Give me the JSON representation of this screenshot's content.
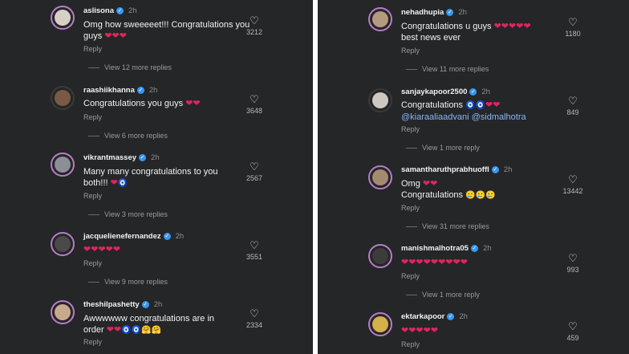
{
  "left": {
    "comments": [
      {
        "user": "aslisona",
        "time": "2h",
        "text": "Omg how sweeeeet!!! Congratulations you guys",
        "emoji": "hearts3",
        "reply": "Reply",
        "likes": "3212",
        "more": "View 12 more replies"
      },
      {
        "user": "raashiikhanna",
        "time": "2h",
        "text": "Congratulations you guys",
        "emoji": "hearts2",
        "reply": "Reply",
        "likes": "3648",
        "more": "View 6 more replies"
      },
      {
        "user": "vikrantmassey",
        "time": "2h",
        "text": "Many many congratulations to you both!!!",
        "emoji": "heart-eye",
        "reply": "Reply",
        "likes": "2567",
        "more": "View 3 more replies"
      },
      {
        "user": "jacquelienefernandez",
        "time": "2h",
        "text": "",
        "emoji": "hearts5",
        "reply": "Reply",
        "likes": "3551",
        "more": "View 9 more replies"
      },
      {
        "user": "theshilpashetty",
        "time": "2h",
        "text": "Awwwwww congratulations are in order",
        "emoji": "mix",
        "reply": "Reply",
        "likes": "2334",
        "more": ""
      }
    ]
  },
  "right": {
    "comments": [
      {
        "user": "nehadhupia",
        "time": "2h",
        "text": "Congratulations u guys",
        "text2": "best news ever",
        "emoji": "hearts5",
        "reply": "Reply",
        "likes": "1180",
        "more": "View 11 more replies"
      },
      {
        "user": "sanjaykapoor2500",
        "time": "2h",
        "text": "Congratulations",
        "mentions": "@kiaraaliaadvani @sidmalhotra",
        "emoji": "eyes-hearts",
        "reply": "Reply",
        "likes": "849",
        "more": "View 1 more reply"
      },
      {
        "user": "samantharuthprabhuoffl",
        "time": "2h",
        "text": "Omg",
        "text2": "Congratulations",
        "emoji": "hearts2",
        "reply": "Reply",
        "likes": "13442",
        "more": "View 31 more replies"
      },
      {
        "user": "manishmalhotra05",
        "time": "2h",
        "text": "",
        "emoji": "hearts9",
        "reply": "Reply",
        "likes": "993",
        "more": "View 1 more reply"
      },
      {
        "user": "ektarkapoor",
        "time": "2h",
        "text": "",
        "emoji": "hearts5",
        "reply": "Reply",
        "likes": "459",
        "more": ""
      }
    ]
  },
  "icons": {
    "like": "heart-outline-icon",
    "verified": "verified-badge-icon"
  },
  "colors": {
    "background": "#252627",
    "heart": "#e0245e",
    "verified": "#3797f0"
  }
}
